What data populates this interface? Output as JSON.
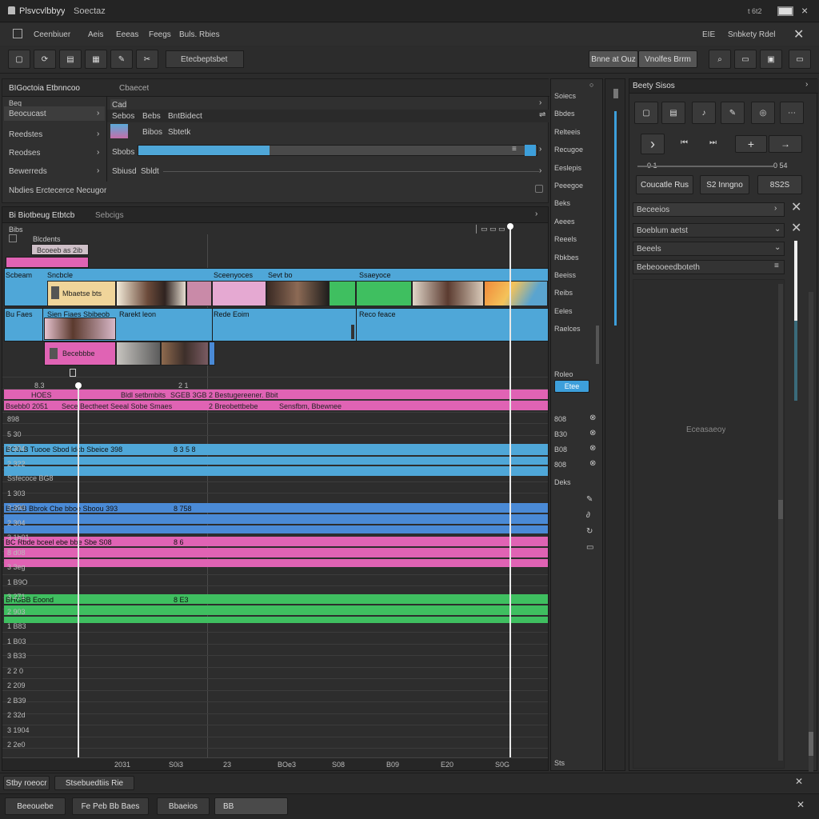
{
  "window": {
    "title": "Plsvcvlbbyy",
    "subtitle": "Soectaz",
    "clock": "t 6t2",
    "close_symbol": "×"
  },
  "menu": {
    "items": [
      "Ceenbiuer",
      "Aeis",
      "Eeeas",
      "Feegs",
      "Buls. Rbies"
    ],
    "right": [
      "EIE",
      "Snbkety Rdel"
    ]
  },
  "toolbar": {
    "search_value": "Etecbeptsbet",
    "right_buttons": [
      "Bnne at Ouz",
      "Vnolfes Brrm"
    ]
  },
  "browser": {
    "tab1": "BIGoctoia Etbnncoo",
    "tab2": "Cbaecet",
    "search_text": "Cad",
    "tree_header": "Beq",
    "items": [
      "Beocucast",
      "Reedstes",
      "Reodses",
      "Bewerreds"
    ],
    "footer": "Nbdies Erctecerce Necugor",
    "col_headers": [
      "Sebos",
      "Bebs",
      "BntBidect"
    ],
    "row1_a": "Bibos",
    "row1_b": "Sbtetk",
    "row2_a": "Sbobs",
    "row3_a": "Sbiusd",
    "row3_b": "Sbldt"
  },
  "timeline": {
    "tab1": "Bi Biotbeug Etbtcb",
    "tab2": "Sebcigs",
    "sub_header": "Bibs",
    "name_header": "Blcdents",
    "clip_pink_small": "Bcoeeb as 2ib",
    "video_labels": [
      "Scbeam",
      "Sncbcle",
      "Sceenyoces",
      "Sevt bo",
      "Ssaeyoce"
    ],
    "clip_label": "Mbaetse bts",
    "audio_track": "Bu Faes",
    "audio_labels": [
      "Sien Fiaes Sbibeob",
      "Rarekt leon",
      "Rede Eoim",
      "Reco feace"
    ],
    "pink_clip": "Becebbbe",
    "track_rows": [
      {
        "label": "HOES",
        "a": "Bldl setbmbits",
        "b": "SGEB 3GB",
        "c": "2 Bestugereener. Bbit"
      },
      {
        "label": "Bsebb0 2051",
        "a": "Sece Bectheet Seeal Sobe Smaes",
        "c": "2 Breobettbebe",
        "d": "Sensfbm, Bbewnee"
      }
    ],
    "ruler": [
      "8.3",
      "2 1",
      "2",
      "S8",
      "3"
    ],
    "left_nums": [
      "898",
      "5 30",
      "3 304",
      "2 322",
      "Ssfecoce BG8",
      "1 303",
      "3 390",
      "2 304",
      "3 1h01",
      "8 d08",
      "3 3eg",
      "1 B9O",
      "3 271",
      "2 903",
      "1 B83",
      "1 B03",
      "3 B33",
      "2 2 0",
      "2 209",
      "2 B39",
      "2 32d",
      "3 1904",
      "2 2e0"
    ],
    "bottom_ruler": [
      "2031",
      "S0i3",
      "23",
      "BOe3",
      "S08",
      "B09",
      "E20",
      "S0G"
    ],
    "blue_row1": "BC3LB   Tuooe Sbod ldcb Sbeice 398",
    "blue_row1_num": "8 3 5 8",
    "blue_row2": "Bcb2B  Bbrok Cbe bboe   Sboou 393",
    "blue_row2_num": "8 758",
    "pink_row": "BC Rbde  bceel  ebe bbe  Sbe  S08",
    "pink_row_num": "8 6",
    "green_row": "BHGBB  Eoond",
    "green_row_num": "8 E3"
  },
  "middle": {
    "items": [
      "Soiecs",
      "Bbdes",
      "Relteeis",
      "Recugoe",
      "Eeslepis",
      "Peeegoe",
      "Beks",
      "Aeees",
      "Reeels",
      "Rbkbes",
      "Beeiss",
      "Reibs",
      "Eeles",
      "Raelces"
    ],
    "label1": "Roleo",
    "button1": "Etee",
    "nums": [
      "808",
      "B30",
      "B08",
      "808"
    ],
    "label2": "Deks"
  },
  "inspector": {
    "title": "Beety Sisos",
    "timecode_left": "0 1",
    "timecode_right": "0 54",
    "buttons": [
      "Coucatle Rus",
      "S2 Inngno",
      "8S2S"
    ],
    "list_header": "Beceeios",
    "list": [
      "Boeblum aetst",
      "Beeels",
      "Bebeooeedboteth"
    ],
    "center_text": "Eceasaeoy"
  },
  "status": {
    "left": "Stby roeocr",
    "middle": "Stsebuedtiis Rie",
    "right_label": "Sts"
  },
  "bottom": {
    "buttons": [
      "Beeouebe",
      "Fe Peb Bb Baes",
      "Bbaeios",
      "BB"
    ]
  },
  "colors": {
    "pink": "#e063b4",
    "blue": "#4fa7d8",
    "blue2": "#4a8ad6",
    "green": "#3fbf60",
    "accent": "#3d9fdb"
  }
}
